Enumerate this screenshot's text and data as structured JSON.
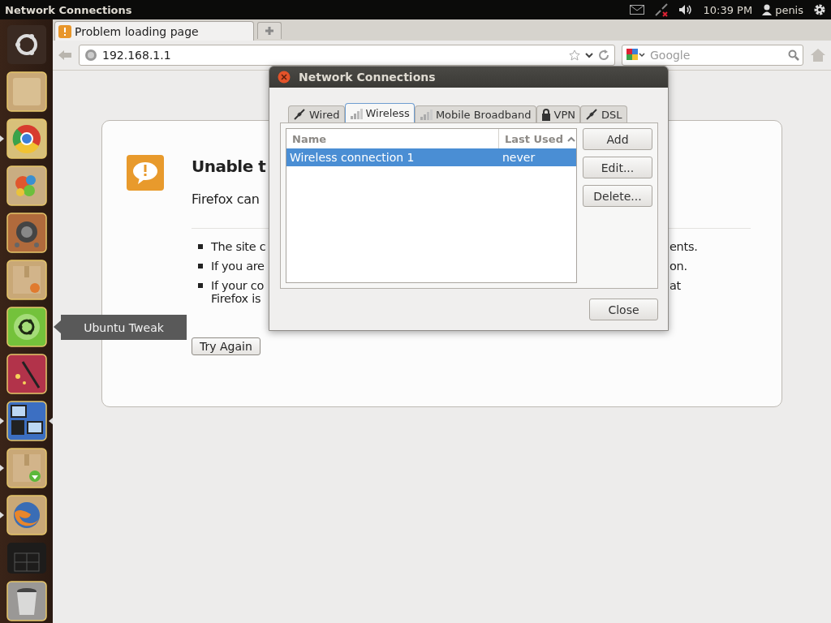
{
  "top_bar": {
    "title": "Network Connections",
    "clock": "10:39 PM",
    "user": "penis"
  },
  "launcher": {
    "items": [
      {
        "kind": "dash",
        "running": false,
        "active": false
      },
      {
        "kind": "files",
        "running": false,
        "active": false
      },
      {
        "kind": "browser",
        "running": true,
        "active": false
      },
      {
        "kind": "paint",
        "running": false,
        "active": false
      },
      {
        "kind": "speaker",
        "running": false,
        "active": false
      },
      {
        "kind": "package",
        "running": false,
        "active": false
      },
      {
        "kind": "tweak",
        "running": false,
        "active": false
      },
      {
        "kind": "wand",
        "running": false,
        "active": false
      },
      {
        "kind": "computers",
        "running": true,
        "active": true
      },
      {
        "kind": "download",
        "running": true,
        "active": false
      },
      {
        "kind": "firefox",
        "running": true,
        "active": false
      },
      {
        "kind": "workspaces",
        "running": false,
        "active": false
      },
      {
        "kind": "trash",
        "running": false,
        "active": false
      }
    ],
    "tooltip": "Ubuntu Tweak"
  },
  "browser": {
    "tab": {
      "title": "Problem loading page"
    },
    "url": "192.168.1.1",
    "search": {
      "placeholder": "Google"
    }
  },
  "error_page": {
    "heading": "Unable t",
    "intro": "Firefox can",
    "bullets": [
      {
        "start": "The site c",
        "end": "ents."
      },
      {
        "start": "If you are",
        "end": "on."
      },
      {
        "start": "If your co",
        "end": "at",
        "next_line": "Firefox is"
      }
    ],
    "button": "Try Again"
  },
  "dialog": {
    "title": "Network Connections",
    "tabs": [
      {
        "label": "Wired",
        "kind": "plug",
        "selected": false
      },
      {
        "label": "Wireless",
        "kind": "bars",
        "selected": true
      },
      {
        "label": "Mobile Broadband",
        "kind": "bars",
        "selected": false
      },
      {
        "label": "VPN",
        "kind": "lock",
        "selected": false
      },
      {
        "label": "DSL",
        "kind": "plug",
        "selected": false
      }
    ],
    "columns": [
      {
        "label": "Name"
      },
      {
        "label": "Last Used",
        "sorted": true
      }
    ],
    "rows": [
      {
        "name": "Wireless connection 1",
        "last_used": "never",
        "selected": true
      }
    ],
    "side_buttons": [
      "Add",
      "Edit...",
      "Delete..."
    ],
    "close": "Close"
  }
}
